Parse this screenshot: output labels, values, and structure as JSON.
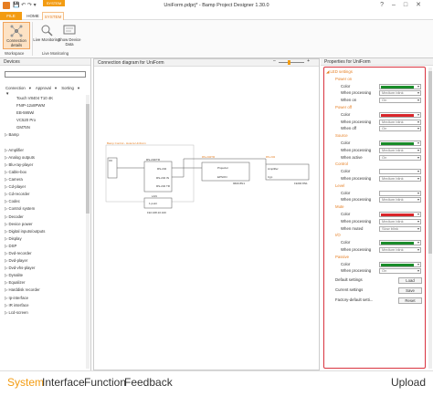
{
  "titlebar": {
    "title": "UniForm.pdprj* - Bamp Project Designer 1.30.0",
    "context_label": "SYSTEM",
    "qat_icons": [
      "save-icon",
      "undo-icon",
      "redo-icon",
      "dropdown-icon"
    ]
  },
  "tabs": {
    "file": "FILE",
    "home": "HOME",
    "system": "SYSTEM"
  },
  "ribbon": {
    "buttons": [
      {
        "label": "Connection details",
        "icon": "connection-icon",
        "active": true
      },
      {
        "label": "Live Monitoring",
        "icon": "monitor-icon",
        "active": false
      },
      {
        "label": "Show Device Data",
        "icon": "device-data-icon",
        "active": false
      }
    ],
    "groups": [
      "Workspace",
      "Live Monitoring"
    ]
  },
  "devices": {
    "title": "Devices",
    "search_value": "",
    "filters": [
      "Connection",
      "Approval",
      "Sorting"
    ],
    "items": [
      {
        "label": "Touch V8404 T10 4K",
        "kind": "sub"
      },
      {
        "label": "FNIP-12x8PWM",
        "kind": "sub"
      },
      {
        "label": "EB-595Wi",
        "kind": "sub"
      },
      {
        "label": "VC520 Pro",
        "kind": "sub"
      },
      {
        "label": "GM75N",
        "kind": "sub"
      },
      {
        "label": "Bamp",
        "kind": "cat"
      },
      {
        "label": "",
        "kind": "sub"
      },
      {
        "label": "Amplifier",
        "kind": "cat"
      },
      {
        "label": "Analog outputs",
        "kind": "cat"
      },
      {
        "label": "Blu-ray-player",
        "kind": "cat"
      },
      {
        "label": "Cable-box",
        "kind": "cat"
      },
      {
        "label": "Camera",
        "kind": "cat"
      },
      {
        "label": "Cd-player",
        "kind": "cat"
      },
      {
        "label": "Cd-recorder",
        "kind": "cat"
      },
      {
        "label": "Codec",
        "kind": "cat"
      },
      {
        "label": "Control system",
        "kind": "cat"
      },
      {
        "label": "Decoder",
        "kind": "cat"
      },
      {
        "label": "Device power",
        "kind": "cat"
      },
      {
        "label": "Digital inputs/outputs",
        "kind": "cat"
      },
      {
        "label": "Display",
        "kind": "cat"
      },
      {
        "label": "DSP",
        "kind": "cat"
      },
      {
        "label": "Dvd-recorder",
        "kind": "cat"
      },
      {
        "label": "Dvd-player",
        "kind": "cat"
      },
      {
        "label": "Dvd-vhs-player",
        "kind": "cat"
      },
      {
        "label": "Dynalite",
        "kind": "cat"
      },
      {
        "label": "Equalizer",
        "kind": "cat"
      },
      {
        "label": "Harddisk recorder",
        "kind": "cat"
      },
      {
        "label": "Ip-interface",
        "kind": "cat"
      },
      {
        "label": "IR interface",
        "kind": "cat"
      },
      {
        "label": "Lcd-screen",
        "kind": "cat"
      }
    ]
  },
  "diagram": {
    "title": "Connection diagram for UniForm",
    "nodes": {
      "control_group": "Bamp Control - Hoteza UniForm",
      "io": "I/O",
      "rs_main": "RS-232/TR",
      "rs_ports": [
        "RS-232",
        "RS-232 IN",
        "RS-232 TR"
      ],
      "lan": "LAN",
      "lan_port": "1 point",
      "lan_ip": "192.168.10.100",
      "projector_tag": "RS-232TR",
      "projector_name": "Projector",
      "projector_model": "EPSON",
      "projector_baud": "9600 8N1",
      "amp_tag": "RS-232",
      "amp_name": "Amplifier",
      "amp_model": "Cyp",
      "amp_baud": "19200 8N1"
    }
  },
  "props": {
    "title": "Properties for UniForm",
    "section": "LED settings",
    "groups": [
      {
        "name": "Power on",
        "color": "#1a8c2a",
        "processing": "Medium blink",
        "when_label": "When on",
        "when_value": "On"
      },
      {
        "name": "Power off",
        "color": "#d9262b",
        "processing": "Medium blink",
        "when_label": "When off",
        "when_value": "On"
      },
      {
        "name": "Source",
        "color": "#1a8c2a",
        "processing": "Medium blink",
        "when_label": "When active",
        "when_value": "On"
      },
      {
        "name": "Control",
        "color": "",
        "processing": "Medium blink",
        "when_label": "",
        "when_value": ""
      },
      {
        "name": "Level",
        "color": "",
        "processing": "Medium blink",
        "when_label": "",
        "when_value": ""
      },
      {
        "name": "Mute",
        "color": "#d9262b",
        "processing": "Medium blink",
        "when_label": "When muted",
        "when_value": "Slow blink"
      },
      {
        "name": "I/O",
        "color": "#1a8c2a",
        "processing": "Medium blink",
        "when_label": "",
        "when_value": ""
      },
      {
        "name": "Passive",
        "color": "#1a8c2a",
        "processing": "On",
        "when_label": "",
        "when_value": ""
      }
    ],
    "color_label": "Color",
    "processing_label": "When processing",
    "default_settings": {
      "label": "Default settings",
      "button": "Load"
    },
    "current_settings": {
      "label": "Current settings",
      "button": "Save"
    },
    "factory_settings": {
      "label": "Factory-default setti...",
      "button": "Reset"
    }
  },
  "bottom": {
    "nav": [
      "System",
      "Interface",
      "Function",
      "Feedback"
    ],
    "active": "System",
    "upload": "Upload"
  }
}
